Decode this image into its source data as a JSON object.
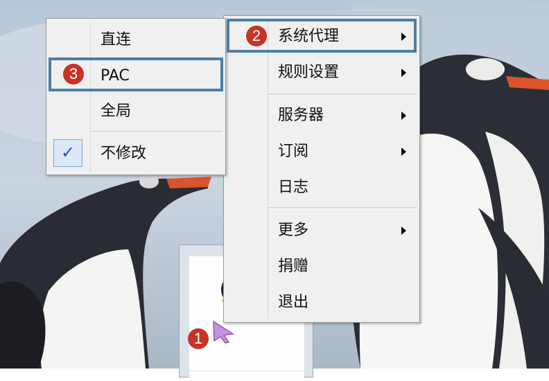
{
  "main_menu": {
    "items": [
      {
        "label": "系统代理",
        "has_submenu": true
      },
      {
        "label": "规则设置",
        "has_submenu": true
      },
      {
        "label": "服务器",
        "has_submenu": true
      },
      {
        "label": "订阅",
        "has_submenu": true
      },
      {
        "label": "日志",
        "has_submenu": false
      },
      {
        "label": "更多",
        "has_submenu": true
      },
      {
        "label": "捐赠",
        "has_submenu": false
      },
      {
        "label": "退出",
        "has_submenu": false
      }
    ]
  },
  "proxy_submenu": {
    "items": [
      {
        "label": "直连",
        "checked": false
      },
      {
        "label": "PAC",
        "checked": false
      },
      {
        "label": "全局",
        "checked": false
      },
      {
        "label": "不修改",
        "checked": true
      }
    ],
    "check_glyph": "✓"
  },
  "annotations": {
    "step1": "1",
    "step2": "2",
    "step3": "3",
    "badge_color": "#c93227",
    "highlight_color": "#4a7ea8"
  },
  "icons": {
    "tray": "penguin-icon",
    "cursor": "arrow-cursor-icon"
  }
}
